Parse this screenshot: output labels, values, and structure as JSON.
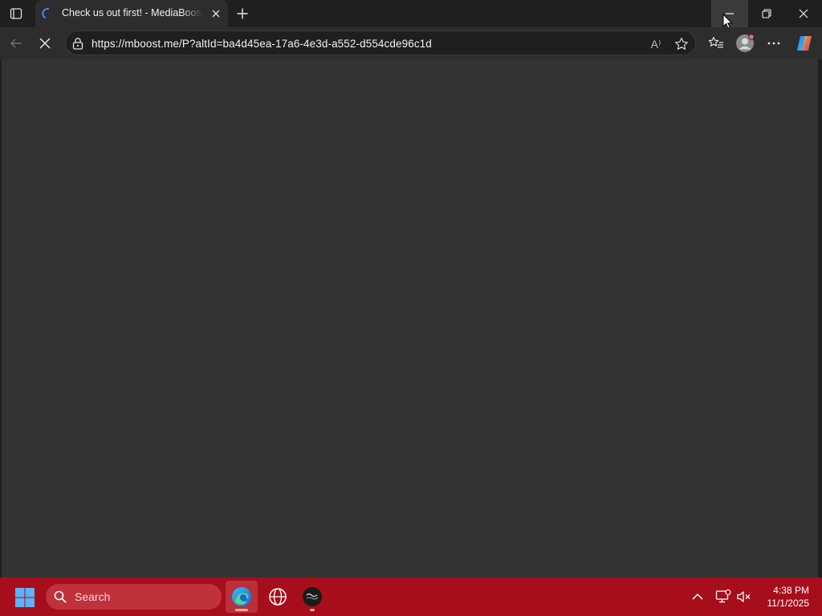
{
  "browser": {
    "tab": {
      "title": "Check us out first! - MediaBoostery",
      "favicon": "loading-spinner-icon"
    },
    "address": {
      "url": "https://mboost.me/P?altId=ba4d45ea-17a6-4e3d-a552-d554cde96c1d"
    },
    "read_aloud_label": "A⁾"
  },
  "taskbar": {
    "search_placeholder": "Search",
    "clock": {
      "time": "4:38 PM",
      "date": "11/1/2025"
    }
  },
  "colors": {
    "taskbar": "#a60e1b",
    "page_background": "#333333",
    "chrome_background": "#1f1f1f",
    "toolbar_background": "#2d2d2d"
  }
}
